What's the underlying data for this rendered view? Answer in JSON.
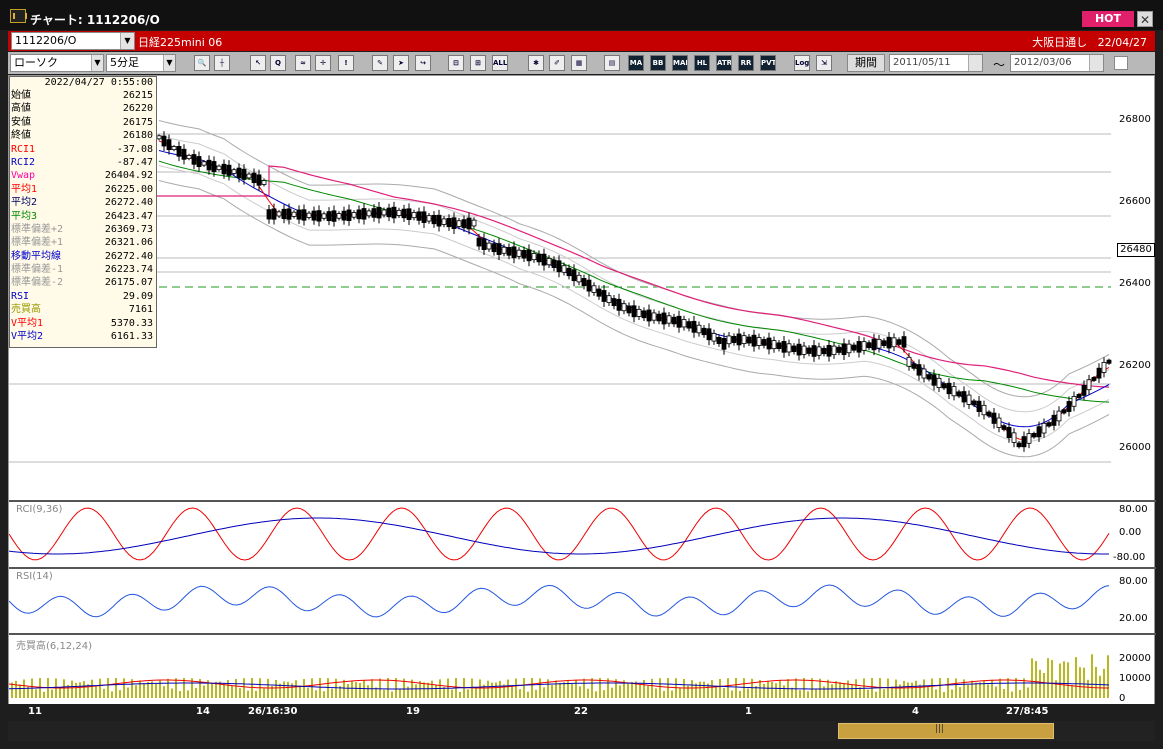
{
  "window": {
    "title": "チャート: 1112206/O",
    "hot_label": "HOT",
    "close_label": "✕"
  },
  "header": {
    "symbol": "1112206/O",
    "name": "日経225mini 06",
    "market": "大阪日通し",
    "date": "22/04/27"
  },
  "toolbar": {
    "chart_type": "ローソク",
    "interval": "5分足",
    "buttons": [
      "MA",
      "BB",
      "MAE",
      "HL",
      "ATR",
      "RR",
      "PVT",
      "Log",
      "ALL"
    ],
    "period_label": "期間",
    "date_from": "2011/05/11",
    "date_to": "2012/03/06",
    "tilde": "〜"
  },
  "datawin": {
    "datetime": "2022/04/27 0:55:00",
    "rows": [
      {
        "label": "始値",
        "value": "26215",
        "color": "#000000"
      },
      {
        "label": "高値",
        "value": "26220",
        "color": "#000000"
      },
      {
        "label": "安値",
        "value": "26175",
        "color": "#000000"
      },
      {
        "label": "終値",
        "value": "26180",
        "color": "#000000"
      },
      {
        "label": "RCI1",
        "value": "-37.08",
        "color": "#ff0000"
      },
      {
        "label": "RCI2",
        "value": "-87.47",
        "color": "#0000cc"
      },
      {
        "label": "Vwap",
        "value": "26404.92",
        "color": "#ff00aa"
      },
      {
        "label": "平均1",
        "value": "26225.00",
        "color": "#ff0000"
      },
      {
        "label": "平均2",
        "value": "26272.40",
        "color": "#000066"
      },
      {
        "label": "平均3",
        "value": "26423.47",
        "color": "#008800"
      },
      {
        "label": "標準偏差+2",
        "value": "26369.73",
        "color": "#999999"
      },
      {
        "label": "標準偏差+1",
        "value": "26321.06",
        "color": "#999999"
      },
      {
        "label": "移動平均線",
        "value": "26272.40",
        "color": "#0000cc"
      },
      {
        "label": "標準偏差-1",
        "value": "26223.74",
        "color": "#999999"
      },
      {
        "label": "標準偏差-2",
        "value": "26175.07",
        "color": "#999999"
      },
      {
        "label": "RSI",
        "value": "29.09",
        "color": "#0000cc"
      },
      {
        "label": "売買高",
        "value": "7161",
        "color": "#999900"
      },
      {
        "label": "V平均1",
        "value": "5370.33",
        "color": "#ff0000"
      },
      {
        "label": "V平均2",
        "value": "6161.33",
        "color": "#0000cc"
      }
    ]
  },
  "main_axis": {
    "ticks": [
      "26800",
      "26600",
      "26400",
      "26200",
      "26000"
    ],
    "current_price": "26480"
  },
  "panels": {
    "rci": {
      "label": "RCI(9,36)",
      "ticks": [
        "80.00",
        "0.00",
        "-80.00"
      ]
    },
    "rsi": {
      "label": "RSI(14)",
      "ticks": [
        "80.00",
        "20.00"
      ]
    },
    "volume": {
      "label": "売買高(6,12,24)",
      "ticks": [
        "20000",
        "10000",
        "0"
      ]
    }
  },
  "xaxis": {
    "labels": [
      "11",
      "14",
      "26/16:30",
      "19",
      "22",
      "1",
      "4",
      "27/8:45"
    ]
  },
  "colors": {
    "accent": "#c40000",
    "hot": "#e0206a",
    "vwap": "#e0207a",
    "ma_short": "#ff0000",
    "ma_mid": "#0000cc",
    "ma_long": "#008800",
    "bands": "#aaaaaa",
    "volume": "#b8b820"
  }
}
